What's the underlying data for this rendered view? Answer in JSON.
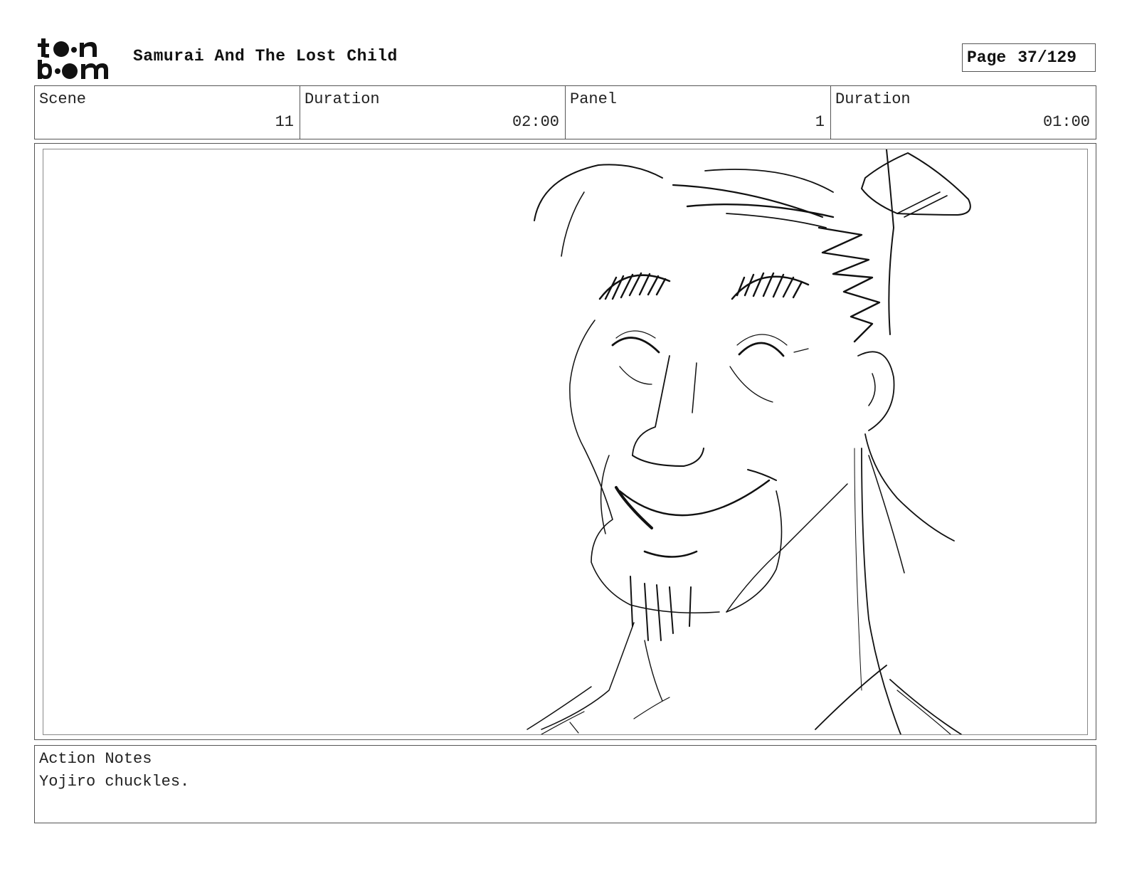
{
  "header": {
    "logo_text": "toon boom",
    "title": "Samurai And The Lost Child",
    "page_label": "Page",
    "page_value": "37/129"
  },
  "info": {
    "scene_label": "Scene",
    "scene_value": "11",
    "scene_duration_label": "Duration",
    "scene_duration_value": "02:00",
    "panel_label": "Panel",
    "panel_value": "1",
    "panel_duration_label": "Duration",
    "panel_duration_value": "01:00"
  },
  "notes": {
    "label": "Action Notes",
    "text": "Yojiro chuckles."
  },
  "colors": {
    "ink": "#111111",
    "border": "#555555"
  }
}
